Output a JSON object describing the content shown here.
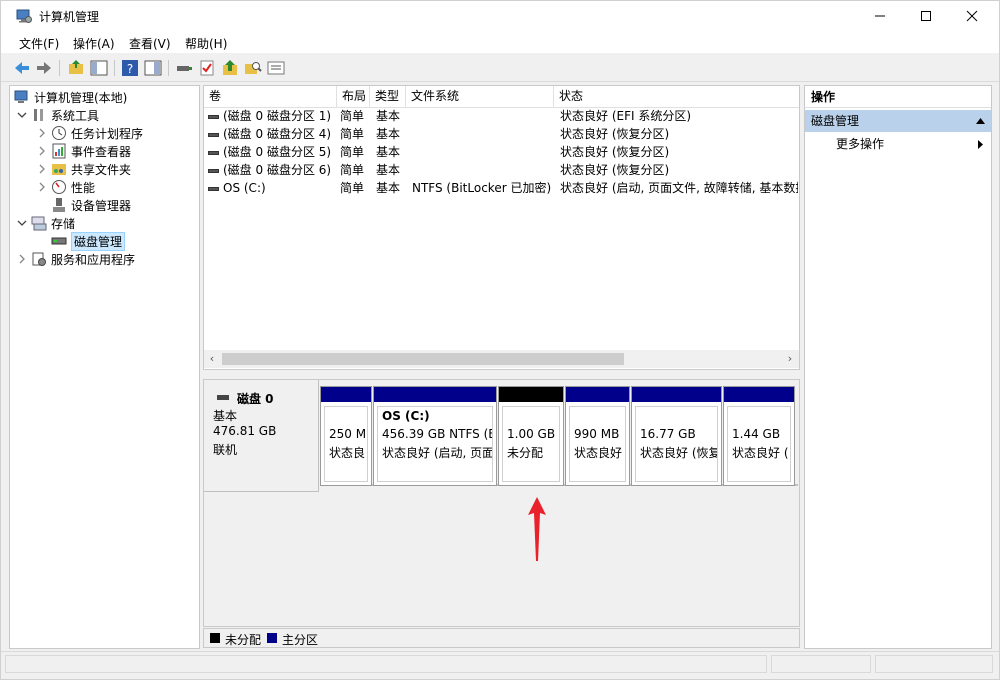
{
  "window": {
    "title": "计算机管理"
  },
  "menu": [
    "文件(F)",
    "操作(A)",
    "查看(V)",
    "帮助(H)"
  ],
  "tree": [
    {
      "label": "计算机管理(本地)",
      "icon": "computer-management-icon"
    },
    {
      "label": "系统工具",
      "icon": "system-tools-icon"
    },
    {
      "label": "任务计划程序",
      "icon": "task-scheduler-icon"
    },
    {
      "label": "事件查看器",
      "icon": "event-viewer-icon"
    },
    {
      "label": "共享文件夹",
      "icon": "shared-folders-icon"
    },
    {
      "label": "性能",
      "icon": "performance-icon"
    },
    {
      "label": "设备管理器",
      "icon": "device-manager-icon"
    },
    {
      "label": "存储",
      "icon": "storage-icon"
    },
    {
      "label": "磁盘管理",
      "icon": "disk-management-icon"
    },
    {
      "label": "服务和应用程序",
      "icon": "services-icon"
    }
  ],
  "list": {
    "columns": [
      "卷",
      "布局",
      "类型",
      "文件系统",
      "状态"
    ],
    "rows": [
      {
        "vol": "(磁盘 0 磁盘分区 1)",
        "layout": "简单",
        "type": "基本",
        "fs": "",
        "status": "状态良好 (EFI 系统分区)"
      },
      {
        "vol": "(磁盘 0 磁盘分区 4)",
        "layout": "简单",
        "type": "基本",
        "fs": "",
        "status": "状态良好 (恢复分区)"
      },
      {
        "vol": "(磁盘 0 磁盘分区 5)",
        "layout": "简单",
        "type": "基本",
        "fs": "",
        "status": "状态良好 (恢复分区)"
      },
      {
        "vol": "(磁盘 0 磁盘分区 6)",
        "layout": "简单",
        "type": "基本",
        "fs": "",
        "status": "状态良好 (恢复分区)"
      },
      {
        "vol": "OS (C:)",
        "layout": "简单",
        "type": "基本",
        "fs": "NTFS (BitLocker 已加密)",
        "status": "状态良好 (启动, 页面文件, 故障转储, 基本数据"
      }
    ]
  },
  "disk": {
    "name": "磁盘 0",
    "kind": "基本",
    "size": "476.81 GB",
    "state": "联机",
    "partitions": [
      {
        "title": "",
        "line1": "250 M",
        "line2": "状态良",
        "kind": "primary"
      },
      {
        "title": "OS  (C:)",
        "line1": "456.39 GB NTFS (B",
        "line2": "状态良好 (启动, 页面",
        "kind": "primary"
      },
      {
        "title": "",
        "line1": "1.00 GB",
        "line2": "未分配",
        "kind": "unallocated"
      },
      {
        "title": "",
        "line1": "990 MB",
        "line2": "状态良好",
        "kind": "primary"
      },
      {
        "title": "",
        "line1": "16.77 GB",
        "line2": "状态良好 (恢复",
        "kind": "primary"
      },
      {
        "title": "",
        "line1": "1.44 GB",
        "line2": "状态良好 (",
        "kind": "primary"
      }
    ]
  },
  "legend": {
    "unallocated": "未分配",
    "primary": "主分区"
  },
  "actions": {
    "header": "操作",
    "section": "磁盘管理",
    "more": "更多操作"
  },
  "colors": {
    "primary": "#00008b",
    "unallocated": "#000000",
    "selection": "#cce8ff",
    "action_section": "#b9d1ea",
    "annotation_arrow": "#e8212a"
  }
}
